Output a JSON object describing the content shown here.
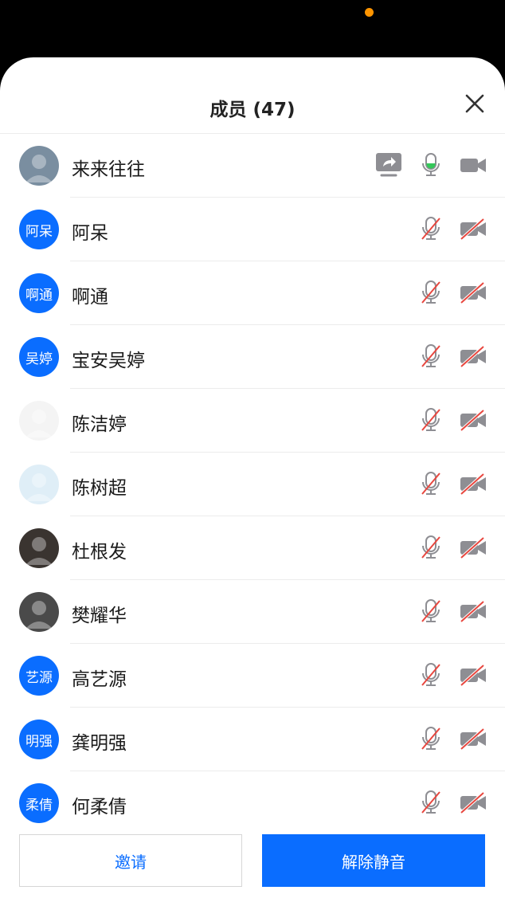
{
  "header": {
    "title": "成员 (47)"
  },
  "members": [
    {
      "name": "来来往往",
      "avatar_type": "photo",
      "avatar_text": "",
      "avatar_color": "#7a8ea0",
      "sharing": true,
      "mic": "active",
      "camera": "on"
    },
    {
      "name": "阿呆",
      "avatar_type": "text",
      "avatar_text": "阿呆",
      "sharing": false,
      "mic": "muted",
      "camera": "off"
    },
    {
      "name": "啊通",
      "avatar_type": "text",
      "avatar_text": "啊通",
      "sharing": false,
      "mic": "muted",
      "camera": "off"
    },
    {
      "name": "宝安吴婷",
      "avatar_type": "text",
      "avatar_text": "吴婷",
      "sharing": false,
      "mic": "muted",
      "camera": "off"
    },
    {
      "name": "陈洁婷",
      "avatar_type": "photo",
      "avatar_text": "",
      "avatar_color": "#f4f4f4",
      "sharing": false,
      "mic": "muted",
      "camera": "off"
    },
    {
      "name": "陈树超",
      "avatar_type": "photo",
      "avatar_text": "",
      "avatar_color": "#dfeef7",
      "sharing": false,
      "mic": "muted",
      "camera": "off"
    },
    {
      "name": "杜根发",
      "avatar_type": "photo",
      "avatar_text": "",
      "avatar_color": "#3a3430",
      "sharing": false,
      "mic": "muted",
      "camera": "off"
    },
    {
      "name": "樊耀华",
      "avatar_type": "photo",
      "avatar_text": "",
      "avatar_color": "#4a4a4a",
      "sharing": false,
      "mic": "muted",
      "camera": "off"
    },
    {
      "name": "高艺源",
      "avatar_type": "text",
      "avatar_text": "艺源",
      "sharing": false,
      "mic": "muted",
      "camera": "off"
    },
    {
      "name": "龚明强",
      "avatar_type": "text",
      "avatar_text": "明强",
      "sharing": false,
      "mic": "muted",
      "camera": "off"
    },
    {
      "name": "何柔倩",
      "avatar_type": "text",
      "avatar_text": "柔倩",
      "sharing": false,
      "mic": "muted",
      "camera": "off"
    }
  ],
  "actions": {
    "invite_label": "邀请",
    "unmute_label": "解除静音"
  },
  "colors": {
    "accent": "#0a6dff",
    "muted_red": "#e8473f",
    "icon_gray": "#8e8e93",
    "active_green": "#34c759"
  }
}
